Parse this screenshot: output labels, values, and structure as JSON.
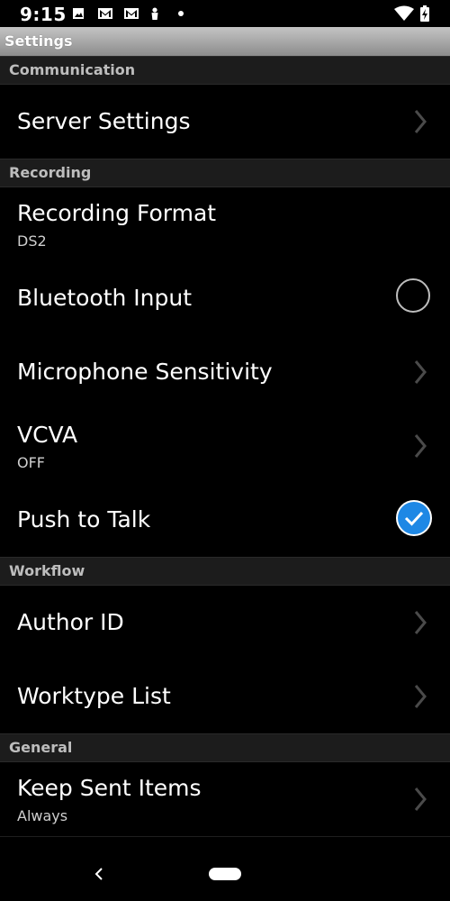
{
  "status_bar": {
    "time": "9:15"
  },
  "header": {
    "title": "Settings"
  },
  "sections": {
    "communication": "Communication",
    "recording": "Recording",
    "workflow": "Workflow",
    "general": "General"
  },
  "rows": {
    "server_settings": {
      "label": "Server Settings"
    },
    "recording_format": {
      "label": "Recording Format",
      "value": "DS2"
    },
    "bluetooth_input": {
      "label": "Bluetooth Input",
      "checked": false
    },
    "microphone_sensitivity": {
      "label": "Microphone Sensitivity"
    },
    "vcva": {
      "label": "VCVA",
      "value": "OFF"
    },
    "push_to_talk": {
      "label": "Push to Talk",
      "checked": true
    },
    "author_id": {
      "label": "Author ID"
    },
    "worktype_list": {
      "label": "Worktype List"
    },
    "keep_sent_items": {
      "label": "Keep Sent Items",
      "value": "Always"
    }
  },
  "colors": {
    "accent": "#1e88e5",
    "section_bg": "#1c1c1c",
    "background": "#000000"
  },
  "icons": [
    "image-icon",
    "gmail-icon",
    "gmail-icon",
    "person-icon",
    "dot-icon",
    "wifi-icon",
    "battery-icon",
    "chevron-right-icon",
    "back-icon",
    "home-pill-icon"
  ]
}
